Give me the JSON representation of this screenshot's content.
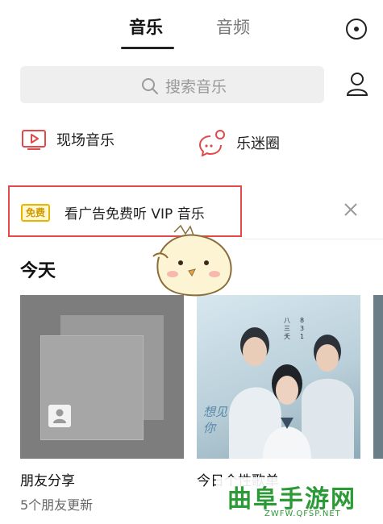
{
  "tabs": {
    "music": "音乐",
    "audio": "音频"
  },
  "search": {
    "placeholder": "搜索音乐"
  },
  "shortcuts": {
    "live_music": "现场音乐",
    "fan_circle": "乐迷圈"
  },
  "ad": {
    "badge": "免费",
    "text": "看广告免费听 VIP 音乐"
  },
  "section": {
    "today": "今天"
  },
  "cards": [
    {
      "title": "朋友分享",
      "subtitle": "5个朋友更新"
    },
    {
      "title": "今日个性歌单",
      "subtitle": ""
    }
  ],
  "album_art": {
    "movie_title": "想见你",
    "vertical_text": "八三夭",
    "numbers": "831"
  },
  "watermark": {
    "title": "曲阜手游网",
    "url": "ZWFW.QFSP.NET"
  },
  "colors": {
    "accent_red": "#e24a4a",
    "badge_yellow": "#e8b600",
    "watermark_green": "#2c9a36"
  }
}
